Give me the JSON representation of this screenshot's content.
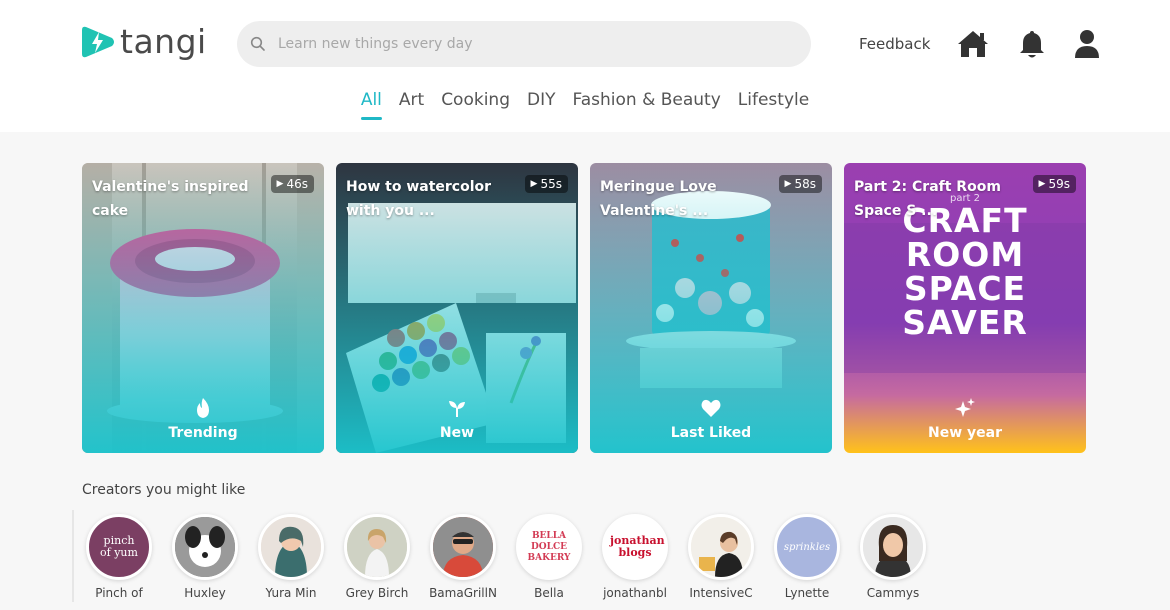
{
  "app": {
    "logo_text": "tangi",
    "brand_color": "#1fb8c6"
  },
  "search": {
    "placeholder": "Learn new things every day",
    "value": ""
  },
  "header": {
    "feedback_label": "Feedback",
    "icons": [
      "home-icon",
      "bell-icon",
      "user-icon"
    ]
  },
  "tabs": [
    {
      "label": "All",
      "active": true
    },
    {
      "label": "Art",
      "active": false
    },
    {
      "label": "Cooking",
      "active": false
    },
    {
      "label": "DIY",
      "active": false
    },
    {
      "label": "Fashion & Beauty",
      "active": false
    },
    {
      "label": "Lifestyle",
      "active": false
    }
  ],
  "cards": [
    {
      "title": "Valentine's inspired cake",
      "duration": "46s",
      "label": "Trending",
      "icon": "flame-icon"
    },
    {
      "title": "How to watercolor with you ...",
      "duration": "55s",
      "label": "New",
      "icon": "sprout-icon"
    },
    {
      "title": "Meringue Love Valentine's ...",
      "duration": "58s",
      "label": "Last Liked",
      "icon": "heart-icon"
    },
    {
      "title": "Part 2: Craft Room Space S ...",
      "duration": "59s",
      "label": "New year",
      "icon": "sparkle-icon",
      "thumb_text": {
        "tag": "part 2",
        "lines": [
          "CRAFT",
          "ROOM",
          "SPACE",
          "SAVER"
        ]
      }
    }
  ],
  "creators": {
    "title": "Creators you might like",
    "items": [
      {
        "name": "Pinch of",
        "avatar_text": "pinch of yum"
      },
      {
        "name": "Huxley",
        "avatar_text": ""
      },
      {
        "name": "Yura Min",
        "avatar_text": ""
      },
      {
        "name": "Grey Birch",
        "avatar_text": ""
      },
      {
        "name": "BamaGrillN",
        "avatar_text": ""
      },
      {
        "name": "Bella",
        "avatar_text": "BELLA DOLCE BAKERY"
      },
      {
        "name": "jonathanbl",
        "avatar_text": "jonathan blogs"
      },
      {
        "name": "IntensiveC",
        "avatar_text": ""
      },
      {
        "name": "Lynette",
        "avatar_text": "sprinkles"
      },
      {
        "name": "Cammys",
        "avatar_text": ""
      }
    ]
  }
}
